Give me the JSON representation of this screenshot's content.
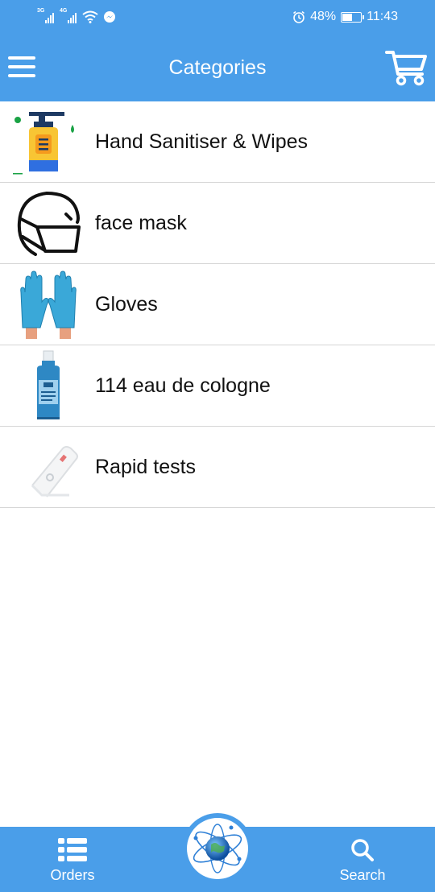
{
  "status_bar": {
    "signal1_tech": "3G",
    "signal2_tech": "4G",
    "battery_percent": "48%",
    "time": "11:43",
    "icons": [
      "signal-icon",
      "signal-icon",
      "wifi-icon",
      "messenger-icon",
      "alarm-icon",
      "battery-icon"
    ]
  },
  "app_bar": {
    "title": "Categories",
    "menu_icon": "hamburger-icon",
    "cart_icon": "cart-icon"
  },
  "categories": [
    {
      "label": "Hand Sanitiser & Wipes",
      "icon": "sanitiser-bottle-icon"
    },
    {
      "label": "face mask",
      "icon": "face-mask-icon"
    },
    {
      "label": "Gloves",
      "icon": "gloves-icon"
    },
    {
      "label": "114 eau de cologne",
      "icon": "cologne-bottle-icon"
    },
    {
      "label": "Rapid tests",
      "icon": "rapid-test-icon"
    }
  ],
  "bottom_nav": {
    "orders_label": "Orders",
    "search_label": "Search",
    "center_icon": "globe-atom-icon"
  },
  "colors": {
    "primary": "#4a9ee9",
    "divider": "#d6d6d6",
    "text": "#111111"
  }
}
